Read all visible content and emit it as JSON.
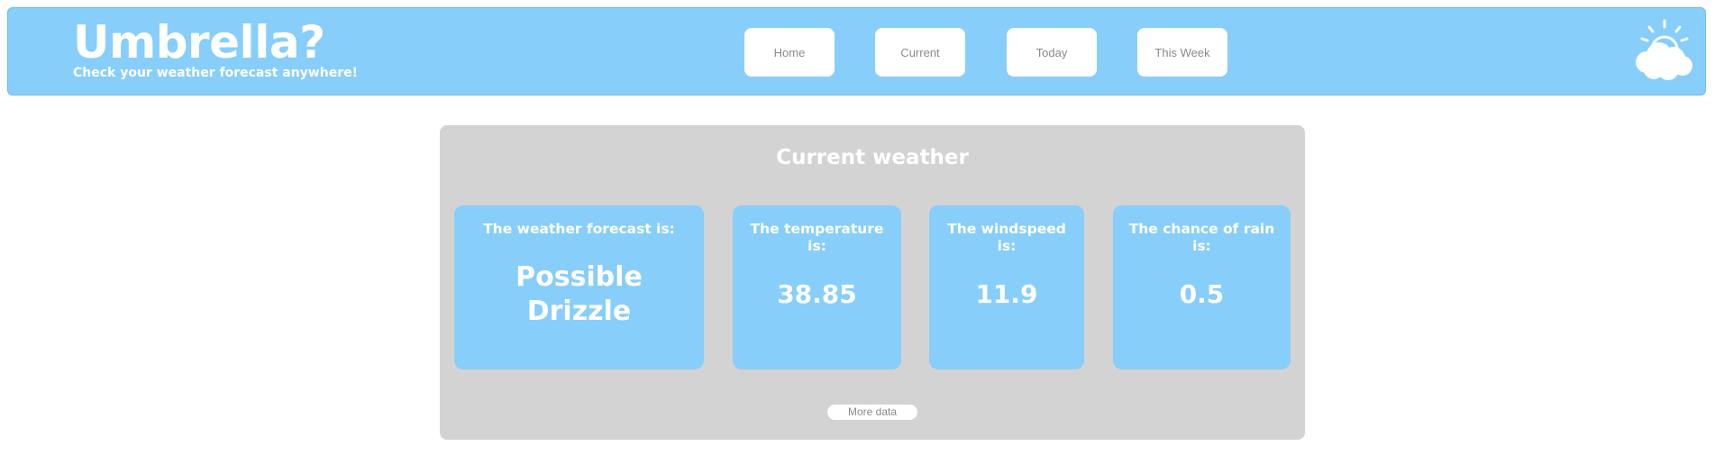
{
  "header": {
    "title": "Umbrella?",
    "tagline": "Check your weather forecast anywhere!",
    "logo_icon": "sun-cloud-icon",
    "background_color": "#87cefa"
  },
  "nav": {
    "items": [
      {
        "label": "Home"
      },
      {
        "label": "Current"
      },
      {
        "label": "Today"
      },
      {
        "label": "This Week"
      }
    ]
  },
  "current": {
    "title": "Current weather",
    "cards": [
      {
        "label": "The weather forecast is:",
        "value": "Possible Drizzle"
      },
      {
        "label": "The temperature is:",
        "value": "38.85"
      },
      {
        "label": "The windspeed is:",
        "value": "11.9"
      },
      {
        "label": "The chance of rain is:",
        "value": "0.5"
      }
    ],
    "more_label": "More data",
    "panel_color": "#d3d3d3",
    "card_color": "#87cefa"
  }
}
